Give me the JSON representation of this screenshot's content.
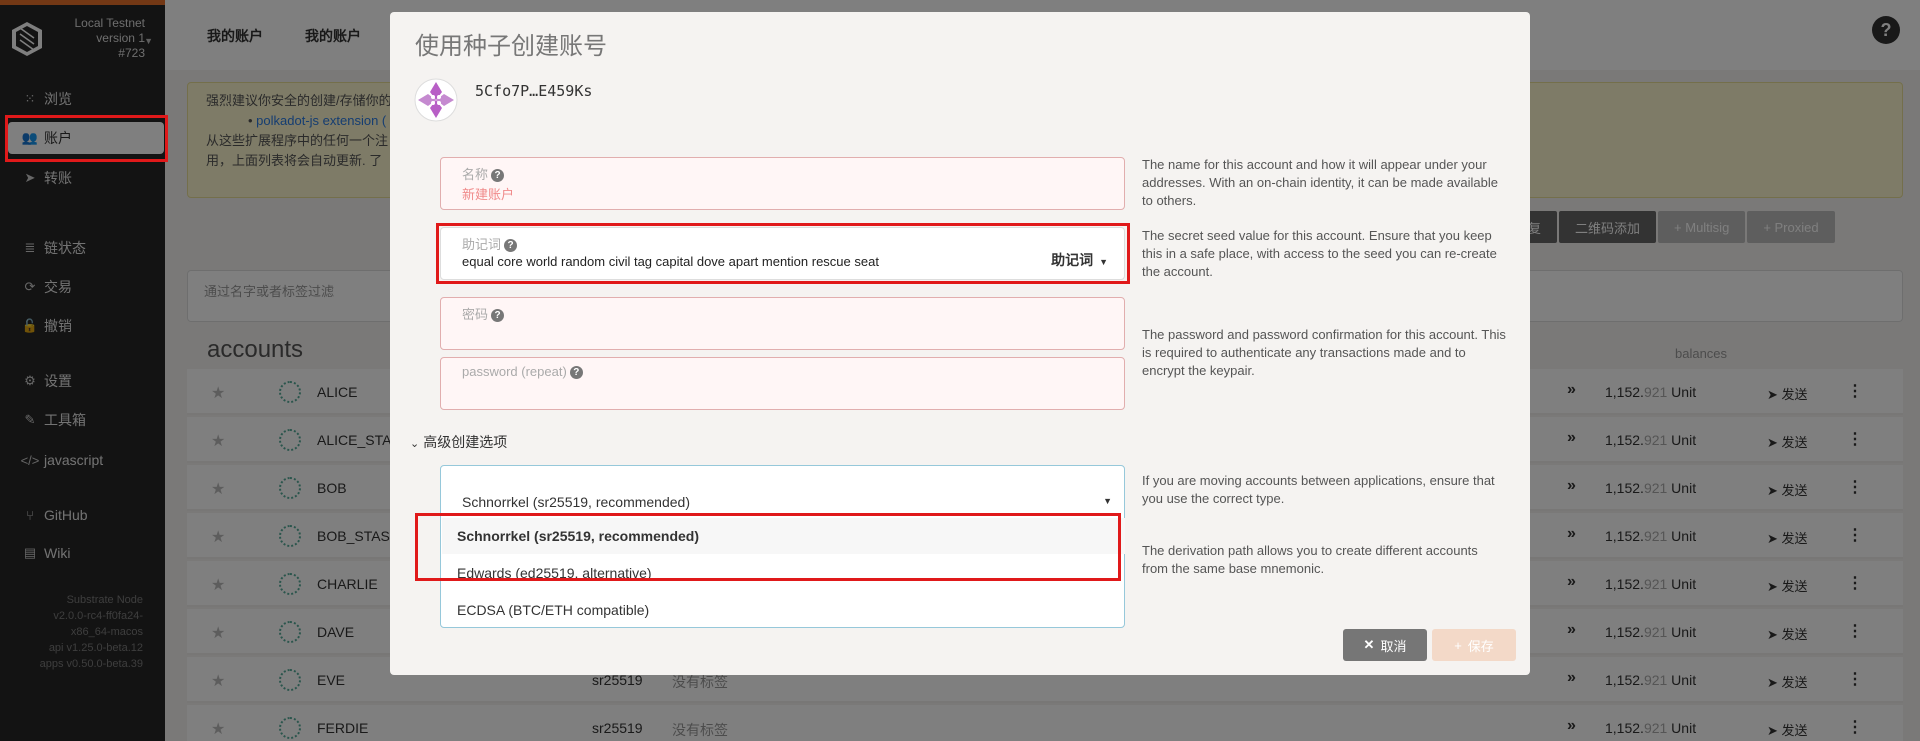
{
  "sidebar": {
    "chain_name": "Local Testnet",
    "chain_version": "version 1",
    "block": "#723",
    "nav": [
      {
        "label": "浏览",
        "icon": "grid-icon"
      },
      {
        "label": "账户",
        "icon": "users-icon"
      },
      {
        "label": "转账",
        "icon": "send-icon"
      },
      {
        "label": "链状态",
        "icon": "database-icon"
      },
      {
        "label": "交易",
        "icon": "sync-icon"
      },
      {
        "label": "撤销",
        "icon": "unlock-icon"
      },
      {
        "label": "设置",
        "icon": "settings-icon"
      },
      {
        "label": "工具箱",
        "icon": "wrench-icon"
      },
      {
        "label": "javascript",
        "icon": "code-icon"
      },
      {
        "label": "GitHub",
        "icon": "github-icon"
      },
      {
        "label": "Wiki",
        "icon": "book-icon"
      }
    ],
    "version_lines": [
      "Substrate Node",
      "v2.0.0-rc4-ff0fa24-",
      "x86_64-macos",
      "api v1.25.0-beta.12",
      "apps v0.50.0-beta.39"
    ]
  },
  "page": {
    "tabs": [
      "我的账户",
      "我的账户"
    ],
    "banner_line1": "强烈建议你安全的创建/存储你的",
    "banner_link": "polkadot-js extension (",
    "banner_line2": "从这些扩展程序中的任何一个注",
    "banner_line3": "用，上面列表将会自动更新. 了",
    "buttons": [
      "复",
      "二维码添加",
      "+ Multisig",
      "+ Proxied"
    ],
    "filter_placeholder": "通过名字或者标签过滤",
    "accounts_title": "accounts",
    "balances_header": "balances",
    "rows": [
      {
        "name": "ALICE",
        "type": "",
        "tags": ""
      },
      {
        "name": "ALICE_STA",
        "type": "",
        "tags": ""
      },
      {
        "name": "BOB",
        "type": "",
        "tags": ""
      },
      {
        "name": "BOB_STAS",
        "type": "",
        "tags": ""
      },
      {
        "name": "CHARLIE",
        "type": "",
        "tags": ""
      },
      {
        "name": "DAVE",
        "type": "",
        "tags": ""
      },
      {
        "name": "EVE",
        "type": "sr25519",
        "tags": "没有标签"
      },
      {
        "name": "FERDIE",
        "type": "sr25519",
        "tags": "没有标签"
      }
    ],
    "balance_int": "1,152.",
    "balance_dec": "921",
    "balance_unit": " Unit",
    "send_label": "发送"
  },
  "modal": {
    "title": "使用种子创建账号",
    "address": "5Cfo7P…E459Ks",
    "name_label": "名称",
    "name_placeholder": "新建账户",
    "seed_label": "助记词",
    "seed_value": "equal core world random civil tag capital dove apart mention rescue seat",
    "seed_type": "助记词",
    "password_label": "密码",
    "password_repeat_label": "password (repeat)",
    "help_name": "The name for this account and how it will appear under your addresses. With an on-chain identity, it can be made available to others.",
    "help_seed": "The secret seed value for this account. Ensure that you keep this in a safe place, with access to the seed you can re-create the account.",
    "help_password": "The password and password confirmation for this account. This is required to authenticate any transactions made and to encrypt the keypair.",
    "advanced_label": "高级创建选项",
    "crypto_selected": "Schnorrkel (sr25519, recommended)",
    "crypto_options": [
      "Schnorrkel (sr25519, recommended)",
      "Edwards (ed25519, alternative)",
      "ECDSA (BTC/ETH compatible)"
    ],
    "help_crypto": "If you are moving accounts between applications, ensure that you use the correct type.",
    "help_derivation": "The derivation path allows you to create different accounts from the same base mnemonic.",
    "cancel_label": "取消",
    "save_label": "保存"
  },
  "colors": {
    "accent": "#e6712b",
    "highlight": "#e0191a",
    "sidebar": "#262626"
  }
}
